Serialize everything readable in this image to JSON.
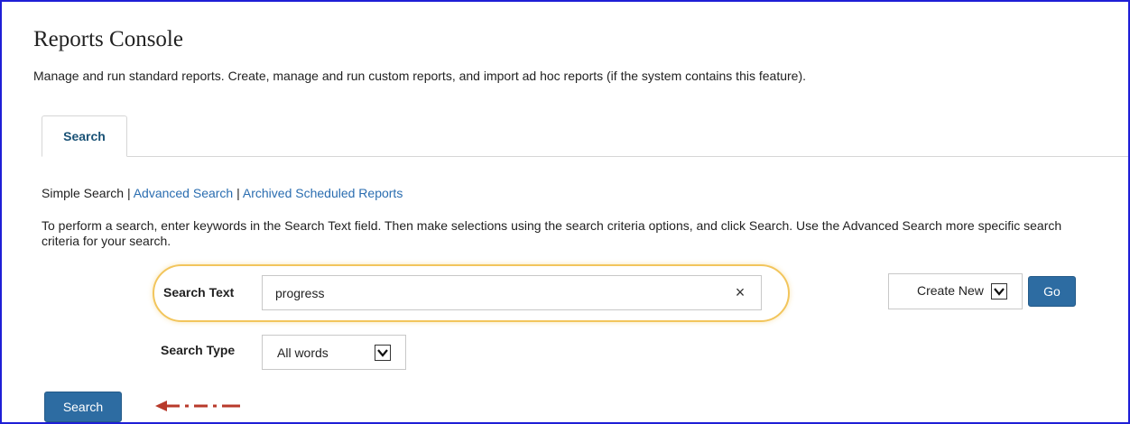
{
  "page": {
    "title": "Reports Console",
    "description": "Manage and run standard reports. Create, manage and run custom reports, and import ad hoc reports (if the system contains this feature)."
  },
  "tabs": [
    {
      "label": "Search",
      "active": true
    }
  ],
  "search_modes": {
    "simple": "Simple Search",
    "separator": "|",
    "advanced": "Advanced Search",
    "archived": "Archived Scheduled Reports"
  },
  "instructions": "To perform a search, enter keywords in the Search Text field. Then make selections using the search criteria options, and click Search. Use the Advanced Search more specific search criteria for your search.",
  "form": {
    "search_text_label": "Search Text",
    "search_text_value": "progress",
    "clear_icon": "×",
    "search_type_label": "Search Type",
    "search_type_value": "All words",
    "create_new_value": "Create New",
    "go_label": "Go",
    "search_button_label": "Search"
  },
  "colors": {
    "link": "#2a6db0",
    "button": "#2d6ca2",
    "tab_label": "#1a5276",
    "highlight_ring": "#f2c55c",
    "annotation_arrow": "#b83a2b",
    "frame_border": "#1f1fd6"
  },
  "icons": {
    "dropdown": "chevron-down-icon",
    "clear": "close-icon",
    "annotation": "dashed-arrow-left-icon"
  }
}
